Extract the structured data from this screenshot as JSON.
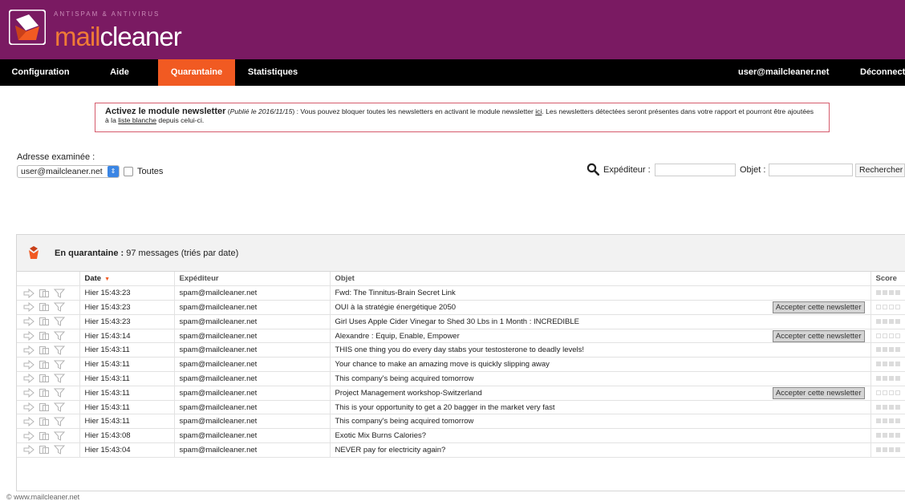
{
  "brand": {
    "tagline": "ANTISPAM & ANTIVIRUS",
    "name_part1": "mail",
    "name_part2": "cleaner",
    "accent_color": "#f15a22",
    "header_color": "#7a1a62"
  },
  "nav": {
    "items": [
      {
        "label": "Configuration"
      },
      {
        "label": "Aide"
      },
      {
        "label": "Quarantaine",
        "active": true
      },
      {
        "label": "Statistiques"
      }
    ],
    "user": "user@mailcleaner.net",
    "logout": "Déconnecter"
  },
  "notice": {
    "title": "Activez le module newsletter",
    "published": "Publié le 2016/11/15",
    "text_1": " : Vous pouvez bloquer toutes les newsletters en activant le module newsletter ",
    "link_1": "ici",
    "text_2": ". Les newsletters détectées seront présentes dans votre rapport et pourront être ajoutées à la ",
    "link_2": "liste blanche",
    "text_3": " depuis celui-ci."
  },
  "address": {
    "label": "Adresse examinée :",
    "selected": "user@mailcleaner.net",
    "all_label": "Toutes"
  },
  "search": {
    "sender_label": "Expéditeur :",
    "subject_label": "Objet :",
    "button": "Rechercher",
    "sender_value": "",
    "subject_value": ""
  },
  "quarantine": {
    "title_bold": "En quarantaine :",
    "title_rest": " 97 messages (triés par date)",
    "columns": {
      "date": "Date",
      "sender": "Expéditeur",
      "subject": "Objet",
      "score": "Score"
    },
    "accept_label": "Accepter cette newsletter",
    "rows": [
      {
        "date": "Hier 15:43:23",
        "sender": "spam@mailcleaner.net",
        "subject": "Fwd: The Tinnitus-Brain Secret Link",
        "newsletter": false
      },
      {
        "date": "Hier 15:43:23",
        "sender": "spam@mailcleaner.net",
        "subject": "OUI à la stratégie énergétique 2050",
        "newsletter": true
      },
      {
        "date": "Hier 15:43:23",
        "sender": "spam@mailcleaner.net",
        "subject": "Girl Uses Apple Cider Vinegar to Shed 30 Lbs in 1 Month : INCREDIBLE",
        "newsletter": false
      },
      {
        "date": "Hier 15:43:14",
        "sender": "spam@mailcleaner.net",
        "subject": "Alexandre : Equip, Enable, Empower",
        "newsletter": true
      },
      {
        "date": "Hier 15:43:11",
        "sender": "spam@mailcleaner.net",
        "subject": "THIS one thing you do every day stabs your testosterone to deadly levels!",
        "newsletter": false
      },
      {
        "date": "Hier 15:43:11",
        "sender": "spam@mailcleaner.net",
        "subject": "Your chance to make an amazing move is quickly slipping away",
        "newsletter": false
      },
      {
        "date": "Hier 15:43:11",
        "sender": "spam@mailcleaner.net",
        "subject": "This company's being acquired tomorrow",
        "newsletter": false
      },
      {
        "date": "Hier 15:43:11",
        "sender": "spam@mailcleaner.net",
        "subject": "Project Management workshop-Switzerland",
        "newsletter": true
      },
      {
        "date": "Hier 15:43:11",
        "sender": "spam@mailcleaner.net",
        "subject": "This is your opportunity to get a 20 bagger in the market very fast",
        "newsletter": false
      },
      {
        "date": "Hier 15:43:11",
        "sender": "spam@mailcleaner.net",
        "subject": "This company's being acquired tomorrow",
        "newsletter": false
      },
      {
        "date": "Hier 15:43:08",
        "sender": "spam@mailcleaner.net",
        "subject": "Exotic Mix Burns Calories?",
        "newsletter": false
      },
      {
        "date": "Hier 15:43:04",
        "sender": "spam@mailcleaner.net",
        "subject": "NEVER pay for electricity again?",
        "newsletter": false
      }
    ]
  },
  "footer": "© www.mailcleaner.net"
}
